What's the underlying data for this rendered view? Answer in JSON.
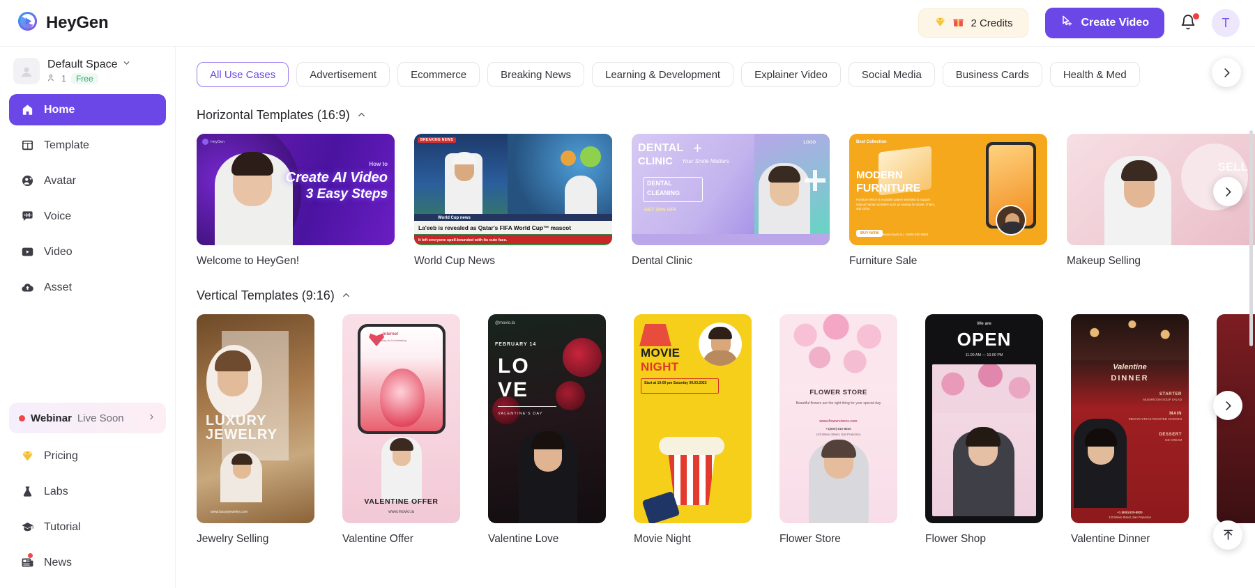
{
  "brand": {
    "name": "HeyGen"
  },
  "topbar": {
    "credits_label": "2 Credits",
    "create_video_label": "Create Video",
    "avatar_initial": "T"
  },
  "sidebar": {
    "space": {
      "name": "Default Space",
      "member_count": "1",
      "plan_badge": "Free"
    },
    "items": [
      {
        "label": "Home",
        "icon": "home-icon",
        "active": true
      },
      {
        "label": "Template",
        "icon": "template-icon",
        "active": false
      },
      {
        "label": "Avatar",
        "icon": "avatar-icon",
        "active": false
      },
      {
        "label": "Voice",
        "icon": "voice-icon",
        "active": false
      },
      {
        "label": "Video",
        "icon": "video-icon",
        "active": false
      },
      {
        "label": "Asset",
        "icon": "asset-cloud-icon",
        "active": false
      }
    ],
    "webinar": {
      "title": "Webinar",
      "status": "Live Soon"
    },
    "bottom_items": [
      {
        "label": "Pricing",
        "icon": "diamond-icon"
      },
      {
        "label": "Labs",
        "icon": "flask-icon"
      },
      {
        "label": "Tutorial",
        "icon": "graduation-cap-icon"
      },
      {
        "label": "News",
        "icon": "news-icon",
        "has_dot": true
      }
    ]
  },
  "filters": {
    "chips": [
      "All Use Cases",
      "Advertisement",
      "Ecommerce",
      "Breaking News",
      "Learning & Development",
      "Explainer Video",
      "Social Media",
      "Business Cards",
      "Health & Med"
    ],
    "active_index": 0
  },
  "sections": [
    {
      "title": "Horizontal Templates (16:9)",
      "collapsed": false,
      "cards": [
        {
          "label": "Welcome to HeyGen!",
          "art": "heygen-intro",
          "headline_small": "How to",
          "headline": "Create AI Video",
          "headline2_pre": "in",
          "headline2": "3 Easy Steps",
          "watermark": "HeyGen"
        },
        {
          "label": "World Cup News",
          "art": "world-cup",
          "badge": "BREAKING NEWS",
          "ticker_label": "World Cup news",
          "headline": "La'eeb is revealed as Qatar's FIFA World Cup™ mascot",
          "subline": "It left everyone spell-bounded with its cute face."
        },
        {
          "label": "Dental Clinic",
          "art": "dental",
          "title_1": "DENTAL",
          "title_2": "CLINIC",
          "tagline": "Your Smile Matters",
          "logo_label": "LOGO",
          "box_1": "DENTAL",
          "box_2": "CLEANING",
          "offer": "GET 20% OFF"
        },
        {
          "label": "Furniture Sale",
          "art": "furniture",
          "eyebrow": "Best Collection",
          "title_1": "MODERN",
          "title_2": "FURNITURE",
          "body": "Furniture which is reusable pattern intended to support various human activities such as seating for stools, chairs, and sofas.",
          "cta": "BUY NOW",
          "contact": "www.movio.la  |  +1800 820 8820"
        },
        {
          "label": "Makeup Selling",
          "art": "makeup",
          "title": "SELL"
        }
      ]
    },
    {
      "title": "Vertical Templates (9:16)",
      "collapsed": false,
      "cards": [
        {
          "label": "Jewelry Selling",
          "art": "jewelry",
          "title_1": "LUXURY",
          "title_2": "JEWELRY",
          "footer": "www.luxuryjewelry.com"
        },
        {
          "label": "Valentine Offer",
          "art": "valentine-offer",
          "script": "Internet",
          "body": "A Beginning for Undertaking",
          "title": "VALENTINE OFFER",
          "url": "www.movio.la"
        },
        {
          "label": "Valentine Love",
          "art": "valentine-love",
          "handle": "@movio.la",
          "date": "FEBRUARY 14",
          "title_1": "LO",
          "title_2": "VE",
          "subtitle": "VALENTINE'S DAY"
        },
        {
          "label": "Movie Night",
          "art": "movie-night",
          "title_1": "MOVIE",
          "title_2": "NIGHT",
          "detail": "Start at 10:00 pm Saturday 09.03.2023"
        },
        {
          "label": "Flower Store",
          "art": "flower-store",
          "title": "FLOWER STORE",
          "body": "Beautiful flowers are the right thing for your special day",
          "url": "www.flowerstores.com",
          "phone": "+1(800) 810-8820",
          "address": "123 Movio Street, San Francisco"
        },
        {
          "label": "Flower Shop",
          "art": "flower-shop",
          "eyebrow": "We are",
          "title": "OPEN",
          "hours": "11.00 AM — 10.00 PM"
        },
        {
          "label": "Valentine Dinner",
          "art": "valentine-dinner",
          "title_1": "Valentine",
          "title_2": "DINNER",
          "course_1": "STARTER",
          "course_1_detail": "MUSHROOM SOUP SALAD",
          "course_2": "MAIN",
          "course_2_detail": "RIB EYE STEAK ROASTED CHICKEN",
          "course_3": "DESSERT",
          "course_3_detail": "ICE CREAM",
          "phone": "+1 (800) 820-8820",
          "address": "123 Movio Street, San Francisco"
        },
        {
          "label": "",
          "art": "partial",
          "title": ""
        }
      ]
    }
  ],
  "colors": {
    "accent": "#6c47e8",
    "accent_soft": "#9a7bf0",
    "credits_bg": "#fdf6e7",
    "alert_red": "#f0474b",
    "text": "#26262b",
    "muted": "#84848f"
  }
}
